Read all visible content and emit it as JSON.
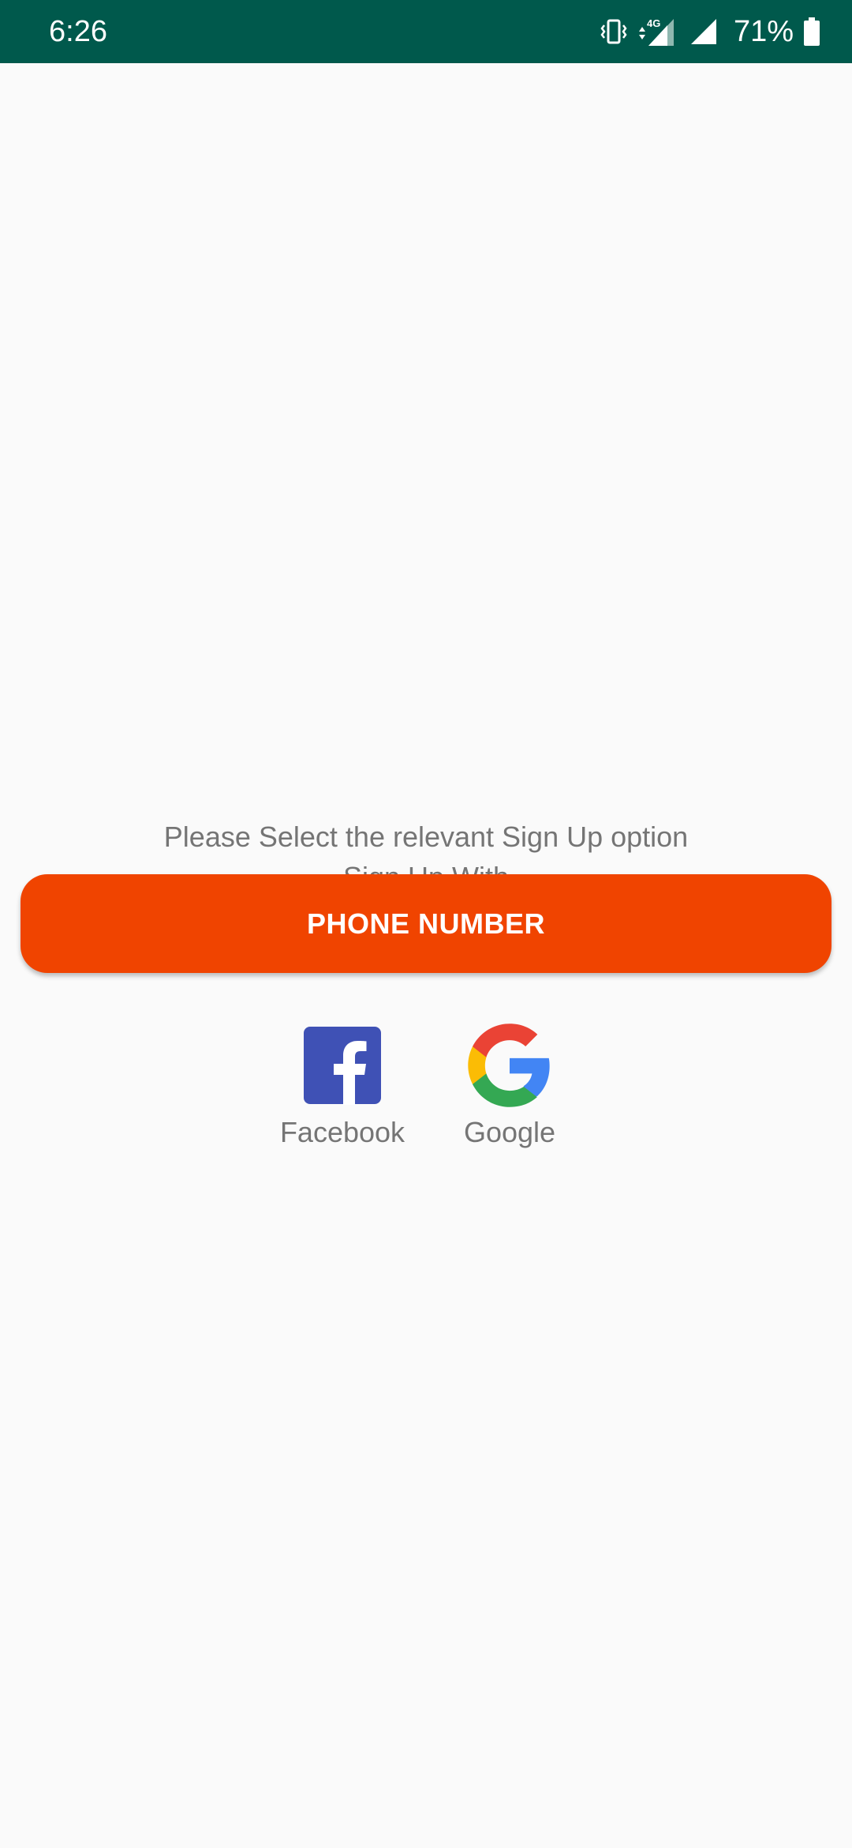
{
  "status_bar": {
    "time": "6:26",
    "network_label": "4G",
    "battery_percent": "71%",
    "colors": {
      "background": "#00594c",
      "foreground": "#ffffff"
    }
  },
  "signup": {
    "prompt_line1": "Please Select the relevant Sign Up option",
    "prompt_line2": "Sign Up With",
    "phone_button_label": "PHONE NUMBER",
    "options": [
      {
        "label": "Facebook",
        "icon": "facebook-icon"
      },
      {
        "label": "Google",
        "icon": "google-icon"
      }
    ]
  },
  "colors": {
    "accent": "#f04400",
    "background": "#fafafa",
    "text_secondary": "#757575",
    "facebook_blue": "#3f51b5"
  }
}
